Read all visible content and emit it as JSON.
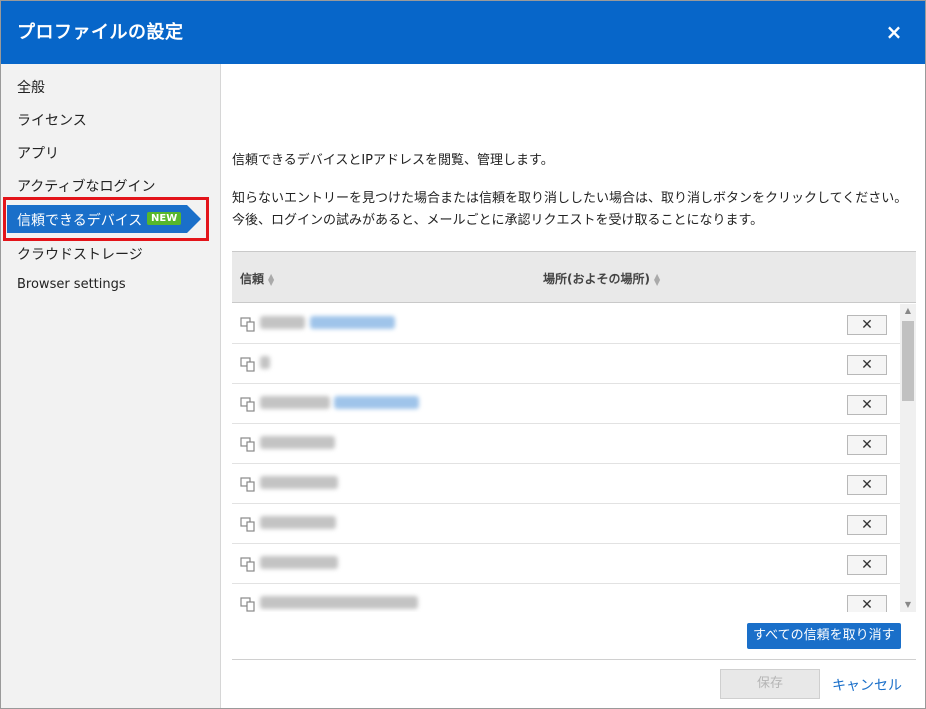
{
  "dialog": {
    "title": "プロファイルの設定",
    "close_label": "×"
  },
  "sidebar": {
    "items": [
      {
        "label": "全般"
      },
      {
        "label": "ライセンス"
      },
      {
        "label": "アプリ"
      },
      {
        "label": "アクティブなログイン"
      },
      {
        "label": "信頼できるデバイス",
        "badge": "NEW",
        "active": true
      },
      {
        "label": "クラウドストレージ"
      },
      {
        "label": "Browser settings"
      }
    ]
  },
  "main": {
    "intro_line": "信頼できるデバイスとIPアドレスを閲覧、管理します。",
    "intro_paragraph": "知らないエントリーを見つけた場合または信頼を取り消ししたい場合は、取り消しボタンをクリックしてください。今後、ログインの試みがあると、メールごとに承認リクエストを受け取ることになります。",
    "table": {
      "columns": [
        "信頼",
        "場所(およその場所)"
      ],
      "revoke_label": "✕",
      "row_count": 8
    },
    "revoke_all_label": "すべての信頼を取り消す",
    "save_label": "保存",
    "cancel_label": "キャンセル"
  },
  "colors": {
    "accent": "#0766c9",
    "active_nav": "#1a6fc9",
    "badge": "#57b72b",
    "highlight_border": "#e3141a"
  }
}
